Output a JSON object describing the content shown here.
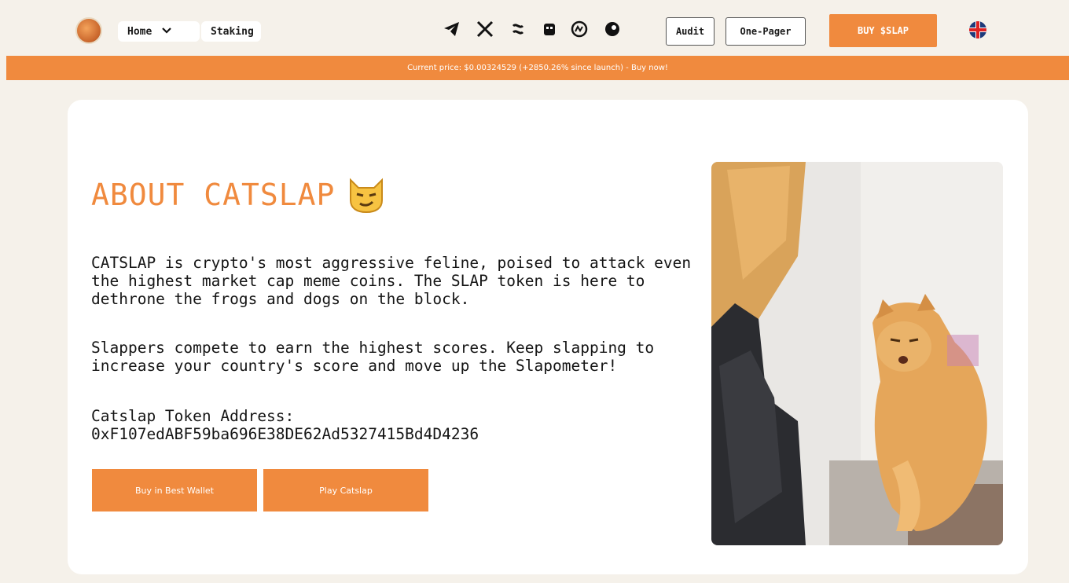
{
  "nav": {
    "home_label": "Home",
    "staking_label": "Staking",
    "socials": [
      "telegram-icon",
      "x-icon",
      "link-icon",
      "lion-icon",
      "coinmarketcap-icon",
      "gecko-icon"
    ],
    "audit_label": "Audit",
    "onepager_label": "One-Pager",
    "buy_label": "BUY $SLAP",
    "language": "uk-flag-icon"
  },
  "price_bar": {
    "text": "Current price: $0.00324529 (+2850.26% since launch) - Buy now!"
  },
  "about": {
    "title": "ABOUT CATSLAP",
    "paragraph1": "CATSLAP is crypto's most aggressive feline, poised to attack even the highest market cap meme coins. The SLAP token is here to dethrone the frogs and dogs on the block.",
    "paragraph2": "Slappers compete to earn the highest scores. Keep slapping to increase your country's score and move up the Slapometer!",
    "token_label": "Catslap Token Address:",
    "token_address": "0xF107edABF59ba696E38DE62Ad5327415Bd4D4236",
    "button_wallet": "Buy in Best Wallet",
    "button_play": "Play Catslap"
  },
  "colors": {
    "accent": "#f08a3e",
    "background": "#f5f1ea",
    "card": "#ffffff"
  }
}
